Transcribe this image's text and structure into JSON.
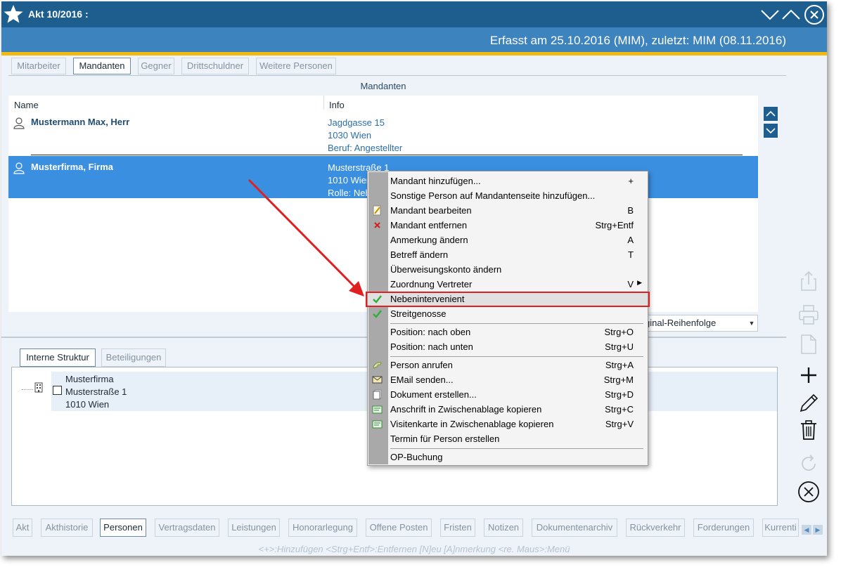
{
  "window": {
    "title": "Akt 10/2016 :",
    "status_line": "Erfasst am 25.10.2016 (MIM), zuletzt: MIM (08.11.2016)"
  },
  "top_tabs": [
    "Mitarbeiter",
    "Mandanten",
    "Gegner",
    "Drittschuldner",
    "Weitere Personen"
  ],
  "active_top_tab": "Mandanten",
  "section_title": "Mandanten",
  "columns": {
    "name": "Name",
    "info": "Info"
  },
  "rows": [
    {
      "name": "Mustermann Max, Herr",
      "info": [
        "Jagdgasse 15",
        "1030 Wien",
        "Beruf: Angestellter"
      ],
      "selected": false
    },
    {
      "name": "Musterfirma, Firma",
      "info": [
        "Musterstraße 1",
        "1010 Wien",
        "Rolle: Neb"
      ],
      "selected": true
    }
  ],
  "sort_dropdown": {
    "value": "ginal-Reihenfolge"
  },
  "lower_tabs": [
    "Interne Struktur",
    "Beteiligungen"
  ],
  "active_lower_tab": "Interne Struktur",
  "tree_item": {
    "lines": [
      "Musterfirma",
      "Musterstraße 1",
      "1010 Wien"
    ]
  },
  "context_menu": {
    "items": [
      {
        "label": "Mandant hinzufügen...",
        "shortcut": "+",
        "icon": ""
      },
      {
        "label": "Sonstige Person auf Mandantenseite hinzufügen...",
        "shortcut": "",
        "icon": ""
      },
      {
        "label": "Mandant bearbeiten",
        "shortcut": "B",
        "icon": "edit-icon"
      },
      {
        "label": "Mandant entfernen",
        "shortcut": "Strg+Entf",
        "icon": "remove-icon"
      },
      {
        "label": "Anmerkung ändern",
        "shortcut": "A",
        "icon": ""
      },
      {
        "label": "Betreff ändern",
        "shortcut": "T",
        "icon": ""
      },
      {
        "label": "Überweisungskonto ändern",
        "shortcut": "",
        "icon": ""
      },
      {
        "label": "Zuordnung Vertreter",
        "shortcut": "V",
        "icon": "",
        "submenu": true
      },
      {
        "label": "Nebenintervenient",
        "shortcut": "",
        "icon": "check-icon",
        "highlighted": true
      },
      {
        "label": "Streitgenosse",
        "shortcut": "",
        "icon": "check-icon"
      },
      {
        "label": "Position: nach oben",
        "shortcut": "Strg+O",
        "icon": ""
      },
      {
        "label": "Position: nach unten",
        "shortcut": "Strg+U",
        "icon": ""
      },
      {
        "label": "Person anrufen",
        "shortcut": "Strg+A",
        "icon": "phone-icon"
      },
      {
        "label": "EMail senden...",
        "shortcut": "Strg+M",
        "icon": "mail-icon"
      },
      {
        "label": "Dokument erstellen...",
        "shortcut": "Strg+D",
        "icon": "document-icon"
      },
      {
        "label": "Anschrift in Zwischenablage kopieren",
        "shortcut": "Strg+C",
        "icon": "card-icon"
      },
      {
        "label": "Visitenkarte in Zwischenablage kopieren",
        "shortcut": "Strg+V",
        "icon": "card-icon"
      },
      {
        "label": "Termin für Person erstellen",
        "shortcut": "",
        "icon": ""
      },
      {
        "label": "OP-Buchung",
        "shortcut": "",
        "icon": ""
      }
    ]
  },
  "bottom_tabs": [
    "Akt",
    "Akthistorie",
    "Personen",
    "Vertragsdaten",
    "Leistungen",
    "Honorarlegung",
    "Offene Posten",
    "Fristen",
    "Notizen",
    "Dokumentenarchiv",
    "Rückverkehr",
    "Forderungen",
    "Kurrenti"
  ],
  "active_bottom_tab": "Personen",
  "hint_text": "<+>:Hinzufügen  <Strg+Entf>:Entfernen  [N]eu  [A]nmerkung  <re. Maus>:Menü",
  "colors": {
    "titlebar": "#1e5e8f",
    "subbar": "#3d83bd",
    "accent": "#f2b90f",
    "selection": "#3b8fe0",
    "annotation": "#e02020"
  }
}
